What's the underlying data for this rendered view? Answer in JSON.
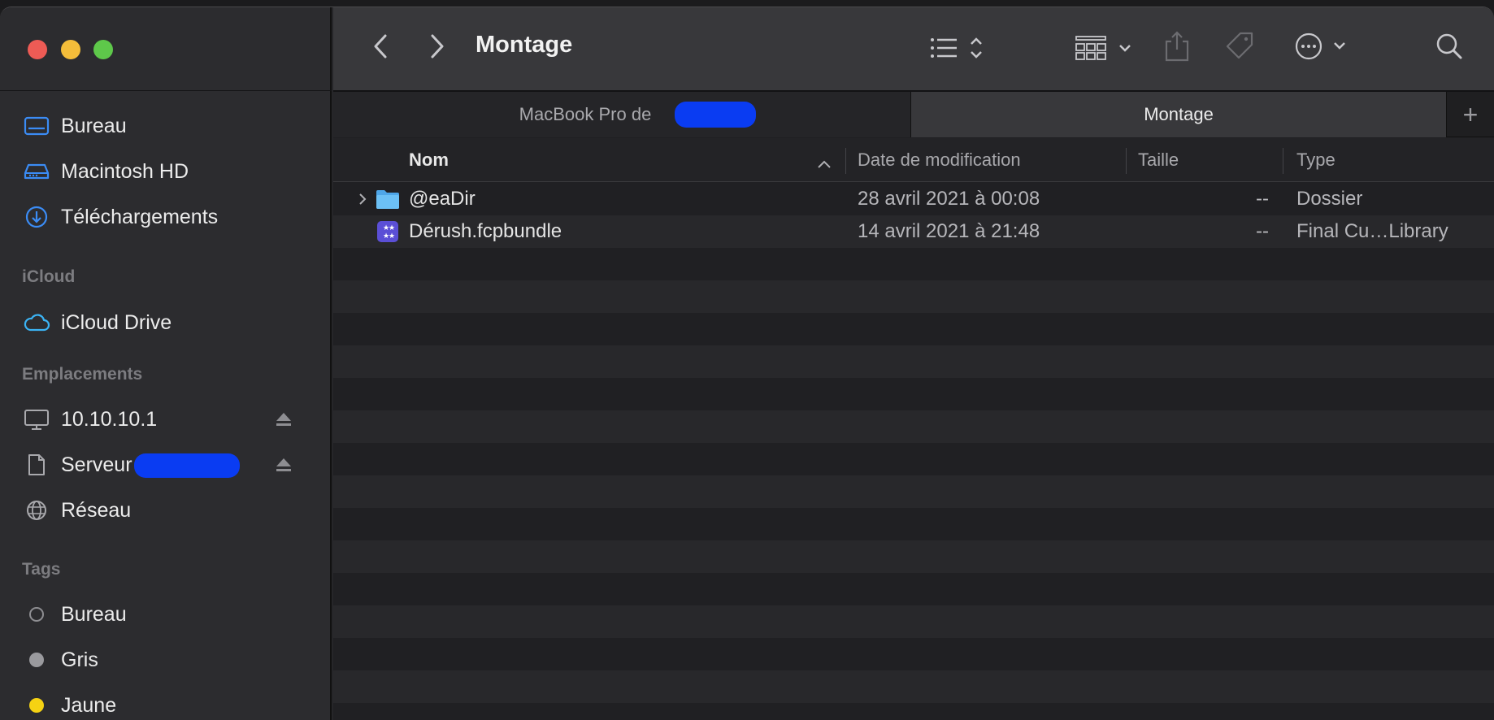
{
  "sidebar": {
    "favorites": [
      {
        "label": "Bureau",
        "icon": "desktop-icon"
      },
      {
        "label": "Macintosh HD",
        "icon": "hard-drive-icon"
      },
      {
        "label": "Téléchargements",
        "icon": "download-icon"
      }
    ],
    "icloud_heading": "iCloud",
    "icloud_items": [
      {
        "label": "iCloud Drive",
        "icon": "cloud-icon"
      }
    ],
    "locations_heading": "Emplacements",
    "locations": [
      {
        "label": "10.10.10.1",
        "icon": "monitor-icon",
        "ejectable": true
      },
      {
        "label": "Serveur",
        "icon": "document-icon",
        "ejectable": true
      },
      {
        "label": "Réseau",
        "icon": "globe-icon",
        "ejectable": false
      }
    ],
    "tags_heading": "Tags",
    "tags": [
      {
        "label": "Bureau",
        "color": "#8e8e92"
      },
      {
        "label": "Gris",
        "color": "#9a9a9e"
      },
      {
        "label": "Jaune",
        "color": "#f5d213"
      }
    ]
  },
  "toolbar": {
    "title": "Montage"
  },
  "tabs": [
    {
      "label": "MacBook Pro de",
      "active": false
    },
    {
      "label": "Montage",
      "active": true
    }
  ],
  "tab_add_label": "+",
  "columns": {
    "name": "Nom",
    "date": "Date de modification",
    "size": "Taille",
    "type": "Type"
  },
  "files": [
    {
      "name": "@eaDir",
      "date": "28 avril 2021 à 00:08",
      "size": "--",
      "type": "Dossier",
      "icon": "folder-icon",
      "expandable": true
    },
    {
      "name": "Dérush.fcpbundle",
      "date": "14 avril 2021 à 21:48",
      "size": "--",
      "type": "Final Cu…Library",
      "icon": "fcp-library-icon",
      "expandable": false
    }
  ],
  "colors": {
    "accent": "#3b8cf5",
    "redaction": "#0a3cf2"
  }
}
